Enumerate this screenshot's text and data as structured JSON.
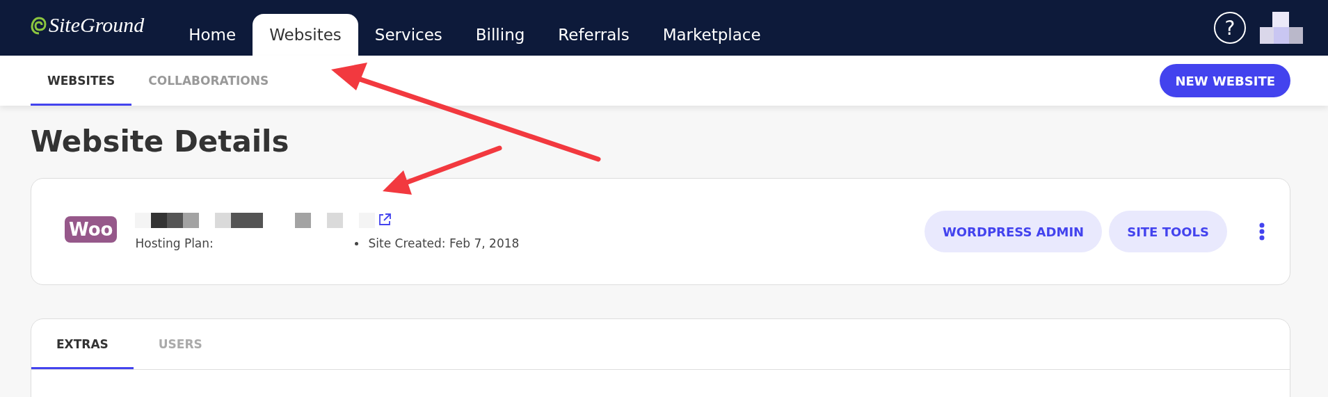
{
  "nav": {
    "logo": "SiteGround",
    "tabs": [
      {
        "label": "Home",
        "selected": false
      },
      {
        "label": "Websites",
        "selected": true
      },
      {
        "label": "Services",
        "selected": false
      },
      {
        "label": "Billing",
        "selected": false
      },
      {
        "label": "Referrals",
        "selected": false
      },
      {
        "label": "Marketplace",
        "selected": false
      }
    ],
    "help": "?"
  },
  "subnav": {
    "tabs": [
      {
        "label": "WEBSITES",
        "selected": true
      },
      {
        "label": "COLLABORATIONS",
        "selected": false
      }
    ],
    "new_button": "NEW WEBSITE"
  },
  "title": "Website Details",
  "website": {
    "logo": "Woo",
    "hosting_plan_label": "Hosting Plan:",
    "created": "Site Created: Feb 7, 2018",
    "actions": [
      "WORDPRESS ADMIN",
      "SITE TOOLS"
    ]
  },
  "detail_tabs": [
    {
      "label": "EXTRAS",
      "selected": true
    },
    {
      "label": "USERS",
      "selected": false
    }
  ]
}
